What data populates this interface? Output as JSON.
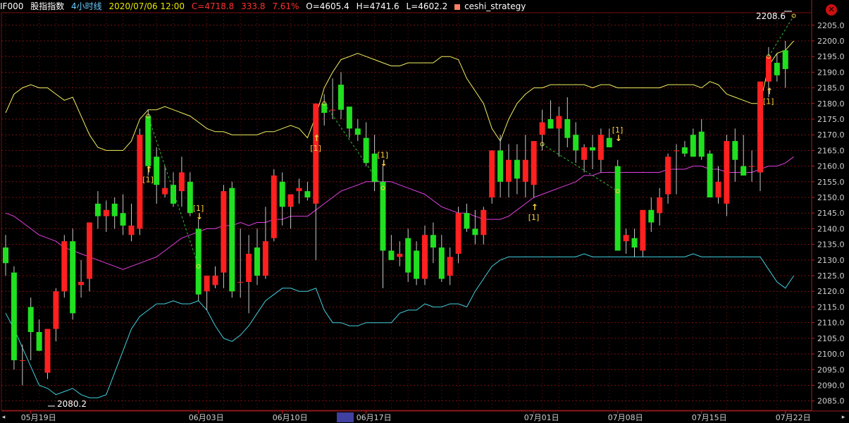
{
  "header": {
    "symbol": "IF000",
    "name": "股指指数",
    "period": "4小时线",
    "datetime": "2020/07/06 12:00",
    "close": "C=4718.8",
    "change": "333.8",
    "change_pct": "7.61%",
    "open": "O=4605.4",
    "high": "H=4741.6",
    "low": "L=4602.2",
    "strategy": "ceshi_strategy"
  },
  "colors": {
    "up": "#ff2020",
    "down": "#20e020",
    "upper_band": "#f0f060",
    "mid_band": "#e040e0",
    "lower_band": "#40d0e0",
    "grid": "#7a1010",
    "axis_text": "#d0d0d0",
    "signal": "#ffd040"
  },
  "chart_data": {
    "type": "candlestick",
    "y_axis_ticks": [
      "2205.0",
      "2200.0",
      "2195.0",
      "2190.0",
      "2185.0",
      "2180.0",
      "2175.0",
      "2170.0",
      "2165.0",
      "2160.0",
      "2155.0",
      "2150.0",
      "2145.0",
      "2140.0",
      "2135.0",
      "2130.0",
      "2125.0",
      "2120.0",
      "2115.0",
      "2110.0",
      "2105.0",
      "2100.0",
      "2095.0",
      "2090.0",
      "2085.0"
    ],
    "ylim": [
      2082,
      2209
    ],
    "x_axis_labels": [
      {
        "label": "05月19日",
        "index": 3
      },
      {
        "label": "06月03日",
        "index": 23
      },
      {
        "label": "06月10日",
        "index": 33
      },
      {
        "label": "06月17日",
        "index": 43
      },
      {
        "label": "07月01日",
        "index": 63
      },
      {
        "label": "07月08日",
        "index": 73
      },
      {
        "label": "07月15日",
        "index": 83
      },
      {
        "label": "07月22日",
        "index": 93
      }
    ],
    "extremes": {
      "high_label": "2208.6",
      "low_label": "2080.2"
    },
    "candles": [
      [
        2134,
        2138,
        2125,
        2129
      ],
      [
        2126,
        2128,
        2095,
        2098
      ],
      [
        2098,
        2103,
        2090,
        2098
      ],
      [
        2115,
        2118,
        2098,
        2107
      ],
      [
        2107,
        2111,
        2101,
        2101
      ],
      [
        2094,
        2108,
        2092,
        2108
      ],
      [
        2108,
        2121,
        2104,
        2120
      ],
      [
        2120,
        2138,
        2118,
        2136
      ],
      [
        2136,
        2140,
        2111,
        2113
      ],
      [
        2122,
        2130,
        2118,
        2123
      ],
      [
        2124,
        2142,
        2120,
        2142
      ],
      [
        2148,
        2152,
        2140,
        2144
      ],
      [
        2144,
        2149,
        2139,
        2146
      ],
      [
        2148,
        2150,
        2140,
        2144
      ],
      [
        2145,
        2151,
        2138,
        2141
      ],
      [
        2138,
        2148,
        2136,
        2141
      ],
      [
        2140,
        2172,
        2138,
        2170
      ],
      [
        2176,
        2178,
        2157,
        2160
      ],
      [
        2163,
        2166,
        2148,
        2154
      ],
      [
        2151,
        2160,
        2150,
        2153
      ],
      [
        2154,
        2158,
        2147,
        2148
      ],
      [
        2152,
        2163,
        2147,
        2158
      ],
      [
        2155,
        2158,
        2144,
        2145
      ],
      [
        2140,
        2143,
        2117,
        2119
      ],
      [
        2120,
        2125,
        2114,
        2125
      ],
      [
        2122,
        2128,
        2121,
        2125
      ],
      [
        2126,
        2154,
        2121,
        2152
      ],
      [
        2153,
        2155,
        2118,
        2120
      ],
      [
        2123,
        2140,
        2118,
        2123
      ],
      [
        2123,
        2138,
        2113,
        2132
      ],
      [
        2134,
        2140,
        2122,
        2125
      ],
      [
        2125,
        2147,
        2124,
        2136
      ],
      [
        2137,
        2159,
        2136,
        2157
      ],
      [
        2155,
        2158,
        2141,
        2147
      ],
      [
        2147,
        2150,
        2140,
        2151
      ],
      [
        2152,
        2156,
        2148,
        2153
      ],
      [
        2152,
        2155,
        2149,
        2150
      ],
      [
        2148,
        2180,
        2130,
        2180
      ],
      [
        2180,
        2183,
        2173,
        2177
      ],
      [
        2178,
        2188,
        2175,
        2178
      ],
      [
        2186,
        2190,
        2175,
        2178
      ],
      [
        2179,
        2176,
        2169,
        2172
      ],
      [
        2172,
        2175,
        2168,
        2170
      ],
      [
        2169,
        2174,
        2160,
        2161
      ],
      [
        2164,
        2170,
        2152,
        2155
      ],
      [
        2155,
        2160,
        2121,
        2133
      ],
      [
        2133,
        2138,
        2130,
        2130
      ],
      [
        2131,
        2136,
        2128,
        2132
      ],
      [
        2137,
        2140,
        2123,
        2126
      ],
      [
        2133,
        2136,
        2122,
        2124
      ],
      [
        2124,
        2141,
        2122,
        2138
      ],
      [
        2138,
        2142,
        2129,
        2134
      ],
      [
        2134,
        2138,
        2123,
        2124
      ],
      [
        2125,
        2134,
        2122,
        2131
      ],
      [
        2132,
        2147,
        2129,
        2145
      ],
      [
        2145,
        2148,
        2139,
        2140
      ],
      [
        2140,
        2146,
        2135,
        2138
      ],
      [
        2138,
        2147,
        2135,
        2146
      ],
      [
        2150,
        2165,
        2148,
        2165
      ],
      [
        2165,
        2170,
        2150,
        2155
      ],
      [
        2155,
        2167,
        2150,
        2162
      ],
      [
        2162,
        2167,
        2151,
        2156
      ],
      [
        2155,
        2170,
        2150,
        2162
      ],
      [
        2154,
        2168,
        2150,
        2168
      ],
      [
        2170,
        2178,
        2165,
        2174
      ],
      [
        2175,
        2181,
        2172,
        2172
      ],
      [
        2172,
        2179,
        2163,
        2176
      ],
      [
        2175,
        2182,
        2166,
        2169
      ],
      [
        2170,
        2174,
        2161,
        2165
      ],
      [
        2162,
        2167,
        2158,
        2166
      ],
      [
        2166,
        2170,
        2159,
        2165
      ],
      [
        2162,
        2172,
        2158,
        2170
      ],
      [
        2169,
        2172,
        2166,
        2166
      ],
      [
        2160,
        2162,
        2133,
        2133
      ],
      [
        2136,
        2140,
        2132,
        2138
      ],
      [
        2137,
        2140,
        2131,
        2134
      ],
      [
        2133,
        2145,
        2131,
        2146
      ],
      [
        2146,
        2150,
        2139,
        2142
      ],
      [
        2145,
        2153,
        2141,
        2150
      ],
      [
        2151,
        2164,
        2148,
        2163
      ],
      [
        2165,
        2167,
        2151,
        2165
      ],
      [
        2166,
        2168,
        2163,
        2164
      ],
      [
        2170,
        2172,
        2168,
        2163
      ],
      [
        2171,
        2175,
        2162,
        2163
      ],
      [
        2164,
        2165,
        2150,
        2150
      ],
      [
        2150,
        2160,
        2148,
        2155
      ],
      [
        2148,
        2170,
        2144,
        2168
      ],
      [
        2168,
        2172,
        2155,
        2162
      ],
      [
        2160,
        2170,
        2157,
        2157
      ],
      [
        2160,
        2165,
        2155,
        2160
      ],
      [
        2158,
        2187,
        2152,
        2187
      ],
      [
        2187,
        2198,
        2182,
        2195
      ],
      [
        2193,
        2196,
        2187,
        2189
      ],
      [
        2197,
        2200,
        2185,
        2191
      ]
    ],
    "upper_band": [
      2177,
      2183,
      2185,
      2186,
      2185,
      2185,
      2183,
      2181,
      2182,
      2176,
      2170,
      2166,
      2165,
      2165,
      2165,
      2168,
      2175,
      2178,
      2178,
      2179,
      2178,
      2177,
      2176,
      2174,
      2172,
      2171,
      2171,
      2170,
      2170,
      2170,
      2170,
      2171,
      2171,
      2172,
      2173,
      2172,
      2169,
      2176,
      2185,
      2190,
      2194,
      2195,
      2196,
      2195,
      2194,
      2193,
      2192,
      2192,
      2193,
      2193,
      2193,
      2193,
      2195,
      2195,
      2194,
      2188,
      2184,
      2180,
      2172,
      2168,
      2175,
      2180,
      2183,
      2185,
      2185,
      2186,
      2186,
      2186,
      2186,
      2186,
      2185,
      2186,
      2186,
      2185,
      2185,
      2185,
      2185,
      2185,
      2185,
      2186,
      2186,
      2186,
      2186,
      2185,
      2187,
      2186,
      2183,
      2182,
      2181,
      2180,
      2180,
      2192,
      2196,
      2197,
      2200
    ],
    "mid_band": [
      2145,
      2144,
      2142,
      2140,
      2138,
      2137,
      2136,
      2134,
      2133,
      2132,
      2131,
      2130,
      2129,
      2128,
      2127,
      2128,
      2129,
      2130,
      2131,
      2133,
      2135,
      2137,
      2138,
      2139,
      2140,
      2140,
      2141,
      2141,
      2142,
      2141,
      2142,
      2142,
      2143,
      2143,
      2144,
      2144,
      2144,
      2146,
      2148,
      2150,
      2152,
      2153,
      2154,
      2155,
      2155,
      2155,
      2155,
      2154,
      2153,
      2152,
      2151,
      2149,
      2147,
      2146,
      2145,
      2145,
      2144,
      2143,
      2143,
      2143,
      2144,
      2146,
      2148,
      2150,
      2151,
      2152,
      2153,
      2154,
      2155,
      2157,
      2157,
      2158,
      2158,
      2158,
      2158,
      2158,
      2158,
      2158,
      2158,
      2159,
      2159,
      2159,
      2160,
      2160,
      2159,
      2159,
      2158,
      2158,
      2158,
      2158,
      2159,
      2160,
      2160,
      2161,
      2163
    ],
    "lower_band": [
      2113,
      2108,
      2102,
      2096,
      2090,
      2089,
      2087,
      2088,
      2089,
      2087,
      2086,
      2086,
      2087,
      2094,
      2101,
      2108,
      2112,
      2114,
      2116,
      2116,
      2117,
      2116,
      2116,
      2117,
      2114,
      2109,
      2105,
      2104,
      2106,
      2109,
      2113,
      2117,
      2119,
      2121,
      2121,
      2120,
      2120,
      2121,
      2114,
      2110,
      2110,
      2109,
      2109,
      2110,
      2110,
      2110,
      2110,
      2113,
      2114,
      2114,
      2116,
      2115,
      2115,
      2116,
      2116,
      2115,
      2120,
      2124,
      2128,
      2130,
      2131,
      2131,
      2131,
      2131,
      2131,
      2131,
      2131,
      2131,
      2131,
      2132,
      2131,
      2131,
      2131,
      2131,
      2131,
      2131,
      2131,
      2131,
      2131,
      2131,
      2131,
      2131,
      2132,
      2131,
      2131,
      2131,
      2131,
      2131,
      2131,
      2131,
      2131,
      2127,
      2123,
      2121,
      2125
    ],
    "signals": [
      {
        "index": 17,
        "dir": "up",
        "label": "[1]",
        "price": 2158
      },
      {
        "index": 23,
        "dir": "down",
        "label": "[1]",
        "price": 2143
      },
      {
        "index": 37,
        "dir": "up",
        "label": "[1]",
        "price": 2168
      },
      {
        "index": 45,
        "dir": "down",
        "label": "[1]",
        "price": 2160
      },
      {
        "index": 63,
        "dir": "up",
        "label": "[1]",
        "price": 2146
      },
      {
        "index": 73,
        "dir": "down",
        "label": "[1]",
        "price": 2168
      },
      {
        "index": 91,
        "dir": "up",
        "label": "[1]",
        "price": 2183
      }
    ],
    "trade_lines": [
      {
        "from_index": 17,
        "from_price": 2176,
        "to_index": 23,
        "to_price": 2128
      },
      {
        "from_index": 38,
        "from_price": 2180,
        "to_index": 45,
        "to_price": 2153
      },
      {
        "from_index": 64,
        "from_price": 2167,
        "to_index": 73,
        "to_price": 2152
      },
      {
        "from_index": 91,
        "from_price": 2195,
        "to_index": 94,
        "to_price": 2208
      }
    ]
  },
  "scrollbar": {
    "left": "◂",
    "right": "▸"
  },
  "close_icon": "✕"
}
